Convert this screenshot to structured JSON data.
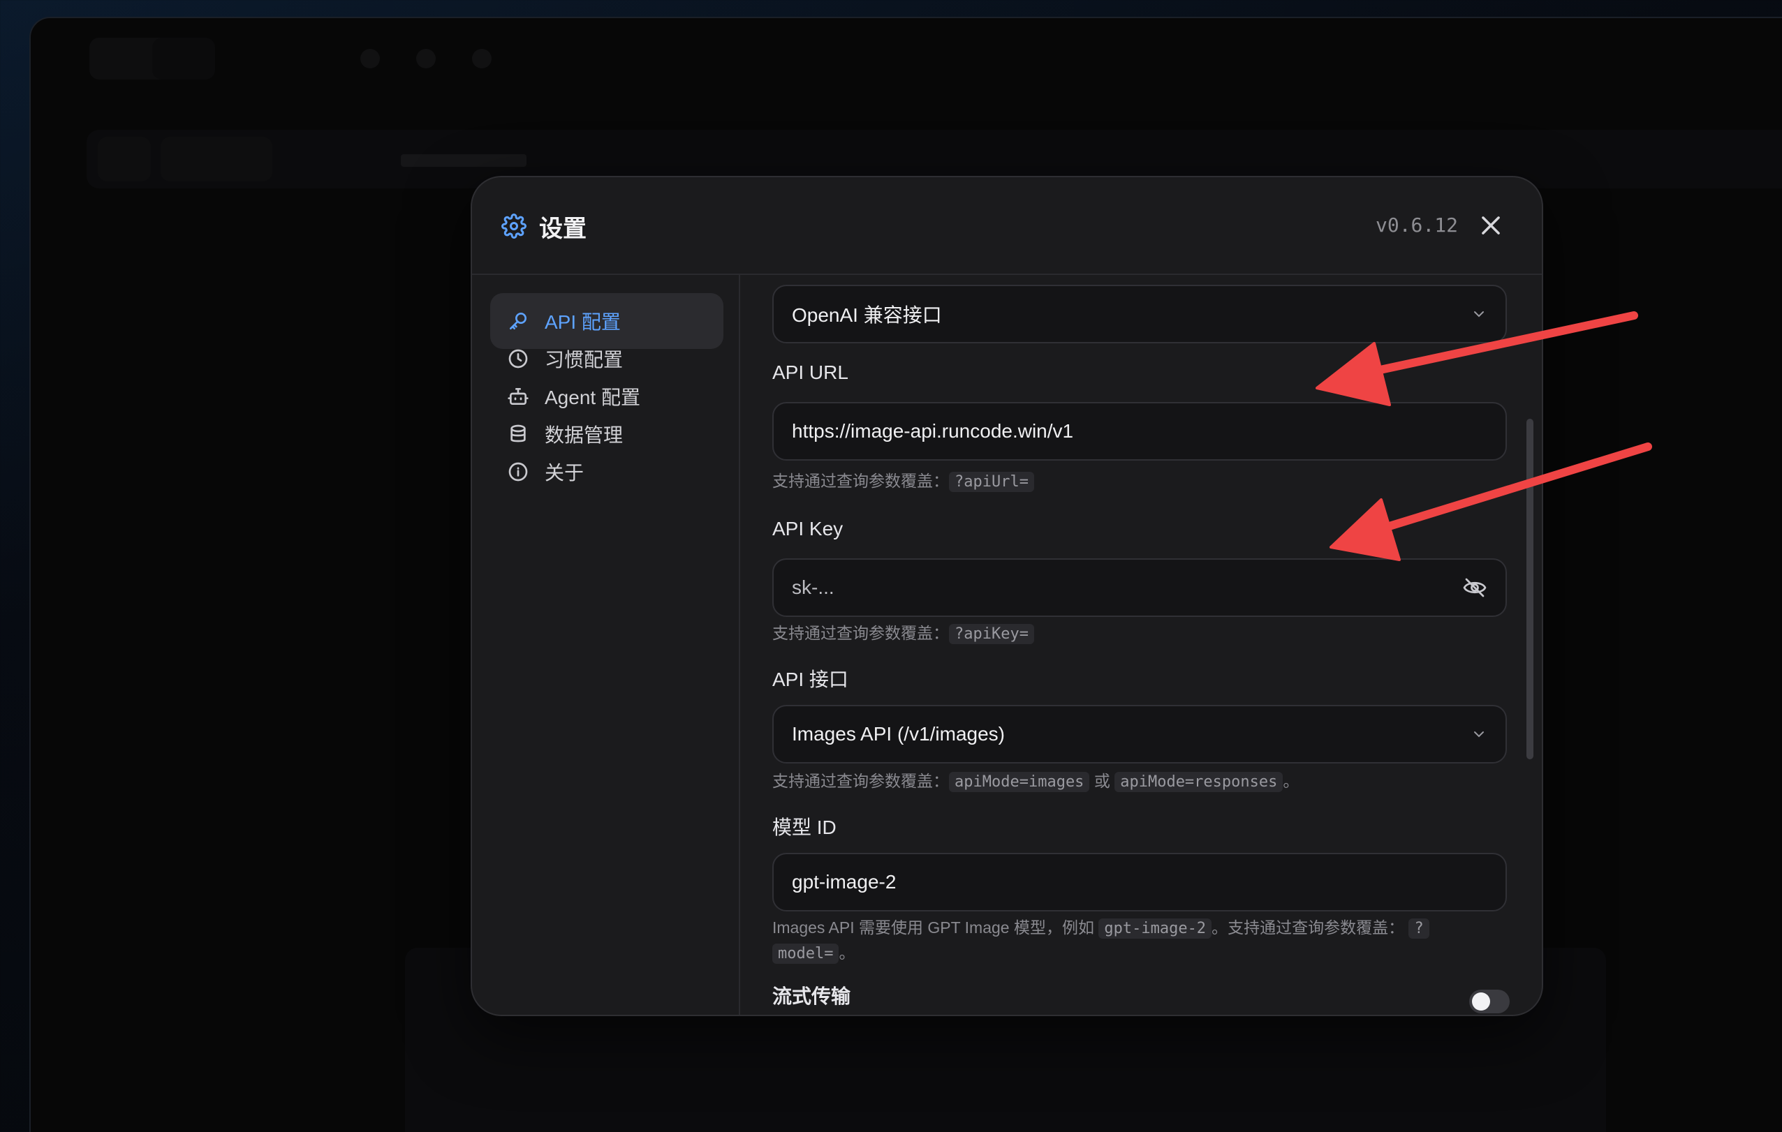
{
  "modal": {
    "title": "设置",
    "version": "v0.6.12"
  },
  "sidebar": {
    "items": [
      {
        "label": "API 配置",
        "icon": "key-icon",
        "active": true
      },
      {
        "label": "习惯配置",
        "icon": "clock-icon",
        "active": false
      },
      {
        "label": "Agent 配置",
        "icon": "bot-icon",
        "active": false
      },
      {
        "label": "数据管理",
        "icon": "database-icon",
        "active": false
      },
      {
        "label": "关于",
        "icon": "info-icon",
        "active": false
      }
    ]
  },
  "form": {
    "provider": {
      "value": "OpenAI 兼容接口"
    },
    "api_url": {
      "label": "API URL",
      "value": "https://image-api.runcode.win/v1",
      "hint_text": "支持通过查询参数覆盖：",
      "hint_code": "?apiUrl="
    },
    "api_key": {
      "label": "API Key",
      "placeholder": "sk-...",
      "hint_text": "支持通过查询参数覆盖：",
      "hint_code": "?apiKey="
    },
    "api_mode": {
      "label": "API 接口",
      "value": "Images API (/v1/images)",
      "hint_text": "支持通过查询参数覆盖：",
      "hint_code1": "apiMode=images",
      "hint_or": "或",
      "hint_code2": "apiMode=responses",
      "hint_end": "。"
    },
    "model_id": {
      "label": "模型 ID",
      "value": "gpt-image-2",
      "hint_part1": "Images API 需要使用 GPT Image 模型，例如",
      "hint_code1": "gpt-image-2",
      "hint_part2": "。支持通过查询参数覆盖：",
      "hint_code2a": "?",
      "hint_code2b": "model=",
      "hint_end": "。"
    },
    "streaming": {
      "label": "流式传输",
      "enabled": false
    }
  },
  "colors": {
    "accent": "#5ea3ff",
    "annotation_arrow": "#ef4444"
  }
}
